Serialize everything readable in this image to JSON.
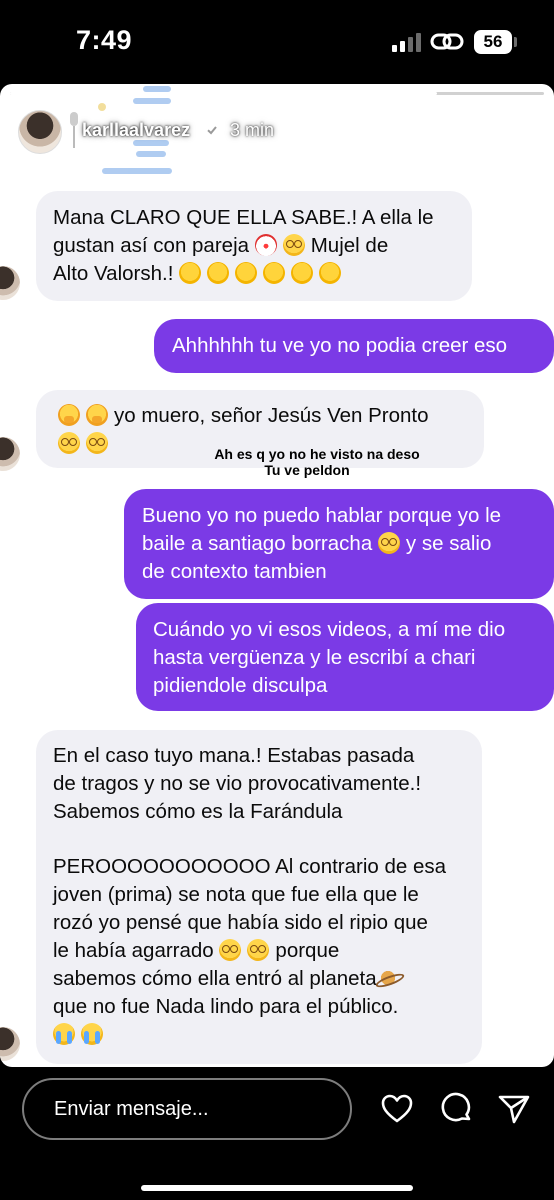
{
  "status_bar": {
    "time": "7:49",
    "battery": "56"
  },
  "story": {
    "progress": 0.8,
    "header": {
      "username": "karllaalvarez",
      "time_ago": "3 min"
    },
    "overlay_text": [
      "Ah es q yo no he visto na deso",
      "Tu ve peldon"
    ],
    "messages": [
      {
        "side": "incoming",
        "text_lines": [
          "Mana CLARO QUE ELLA SABE.! A ella le",
          "gustan así con pareja",
          "Mujel de",
          "Alto Valorsh.!"
        ]
      },
      {
        "side": "outgoing",
        "text": "Ahhhhhh tu ve yo no podia creer eso"
      },
      {
        "side": "incoming",
        "text": "yo muero, señor Jesús Ven Pronto"
      },
      {
        "side": "outgoing",
        "text_lines": [
          "Bueno yo no puedo hablar porque yo le",
          "baile a santiago borracha",
          "y se salio",
          "de contexto tambien"
        ]
      },
      {
        "side": "outgoing",
        "text_lines": [
          "Cuándo yo vi esos videos, a mí me dio",
          "hasta vergüenza y le escribí a chari",
          "pidiendole disculpa"
        ]
      },
      {
        "side": "incoming",
        "text_lines": [
          "En el caso tuyo mana.! Estabas pasada",
          "de tragos y no se vio provocativamente.!",
          "Sabemos cómo es la Farándula",
          "PEROOOOOOOOOOO Al contrario de esa",
          "joven (prima) se nota que fue ella que le",
          "rozó yo pensé que había sido el ripio que",
          "le había agarrado",
          "porque",
          "sabemos cómo ella entró al planeta",
          "que no fue Nada lindo para el público."
        ]
      }
    ]
  },
  "reply_bar": {
    "placeholder": "Enviar mensaje..."
  },
  "icons": [
    "link-icon",
    "verified-icon",
    "menu-icon",
    "close-icon",
    "heart-icon",
    "comment-icon",
    "send-icon"
  ],
  "colors": {
    "outgoing_bubble": "#7b3ae6",
    "incoming_bubble": "#f0f0f5",
    "background": "#000000"
  }
}
